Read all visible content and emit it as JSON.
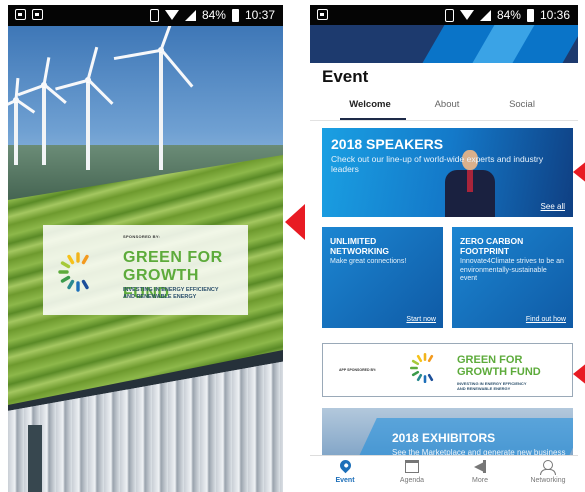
{
  "splash": {
    "status_bar": {
      "battery": "84%",
      "time": "10:37"
    },
    "sponsor_card": {
      "sponsored_by": "SPONSORED BY:",
      "title_line1": "GREEN FOR",
      "title_line2": "GROWTH FUND",
      "subtitle_line1": "INVESTING IN ENERGY EFFICIENCY",
      "subtitle_line2": "AND RENEWABLE ENERGY"
    }
  },
  "app": {
    "status_bar": {
      "battery": "84%",
      "time": "10:36"
    },
    "page_title": "Event",
    "tabs": [
      {
        "label": "Welcome",
        "active": true
      },
      {
        "label": "About"
      },
      {
        "label": "Social"
      }
    ],
    "speakers_card": {
      "title": "2018 SPEAKERS",
      "description": "Check out our line-up of world-wide experts and industry leaders",
      "link": "See all"
    },
    "networking_card": {
      "title_line1": "UNLIMITED",
      "title_line2": "NETWORKING",
      "description": "Make great connections!",
      "link": "Start now"
    },
    "carbon_card": {
      "title_line1": "ZERO CARBON",
      "title_line2": "FOOTPRINT",
      "description": "Innovate4Climate strives to be an environmentally-sustainable event",
      "link": "Find out how"
    },
    "sponsor_banner": {
      "sponsored_by": "APP SPONSORED BY:",
      "title_line1": "GREEN FOR",
      "title_line2": "GROWTH FUND",
      "subtitle_line1": "INVESTING IN ENERGY EFFICIENCY",
      "subtitle_line2": "AND RENEWABLE ENERGY"
    },
    "exhibitors_card": {
      "title": "2018 EXHIBITORS",
      "description": "See the Marketplace and generate new business"
    },
    "bottom_nav": [
      {
        "label": "Event",
        "icon": "location-pin-icon",
        "active": true
      },
      {
        "label": "Agenda",
        "icon": "calendar-icon"
      },
      {
        "label": "More",
        "icon": "megaphone-icon"
      },
      {
        "label": "Networking",
        "icon": "people-icon"
      }
    ]
  },
  "colors": {
    "accent_blue": "#1d6fb9",
    "brand_green": "#5dab3b",
    "arrow_red": "#e81b23",
    "navy": "#1d3a6e"
  }
}
